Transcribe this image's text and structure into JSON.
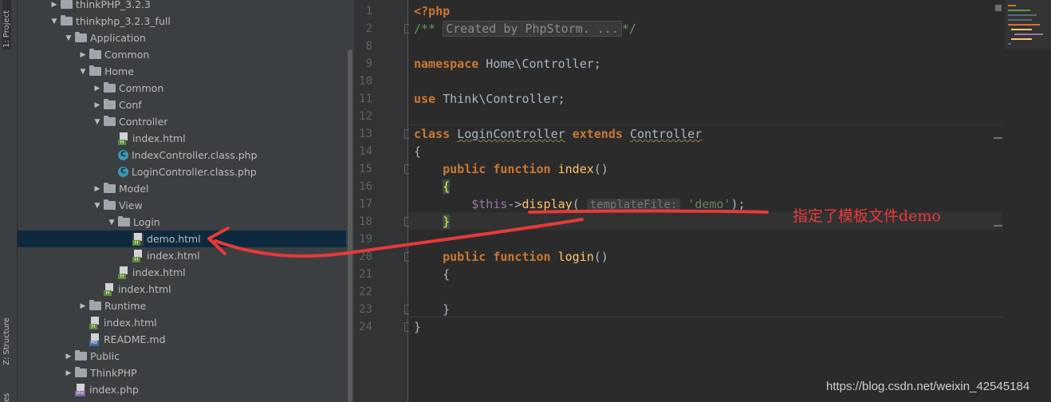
{
  "tool_strip": {
    "project_tab": "1: Project",
    "structure_tab": "Z: Structure",
    "favorites_tab": "es"
  },
  "project_tree": [
    {
      "label": "thinkPHP_3.2.3",
      "kind": "folder",
      "depth": 1,
      "expanded": false
    },
    {
      "label": "thinkphp_3.2.3_full",
      "kind": "folder",
      "depth": 1,
      "expanded": true
    },
    {
      "label": "Application",
      "kind": "folder",
      "depth": 2,
      "expanded": true
    },
    {
      "label": "Common",
      "kind": "folder",
      "depth": 3,
      "expanded": false
    },
    {
      "label": "Home",
      "kind": "folder",
      "depth": 3,
      "expanded": true
    },
    {
      "label": "Common",
      "kind": "folder",
      "depth": 4,
      "expanded": false
    },
    {
      "label": "Conf",
      "kind": "folder",
      "depth": 4,
      "expanded": false
    },
    {
      "label": "Controller",
      "kind": "folder",
      "depth": 4,
      "expanded": true
    },
    {
      "label": "index.html",
      "kind": "html",
      "depth": 5
    },
    {
      "label": "IndexController.class.php",
      "kind": "php-class",
      "depth": 5
    },
    {
      "label": "LoginController.class.php",
      "kind": "php-class",
      "depth": 5
    },
    {
      "label": "Model",
      "kind": "folder",
      "depth": 4,
      "expanded": false
    },
    {
      "label": "View",
      "kind": "folder",
      "depth": 4,
      "expanded": true
    },
    {
      "label": "Login",
      "kind": "folder",
      "depth": 5,
      "expanded": true
    },
    {
      "label": "demo.html",
      "kind": "html",
      "depth": 6,
      "selected": true
    },
    {
      "label": "index.html",
      "kind": "html",
      "depth": 6
    },
    {
      "label": "index.html",
      "kind": "html",
      "depth": 5
    },
    {
      "label": "index.html",
      "kind": "html",
      "depth": 4
    },
    {
      "label": "Runtime",
      "kind": "folder",
      "depth": 3,
      "expanded": false
    },
    {
      "label": "index.html",
      "kind": "html",
      "depth": 3
    },
    {
      "label": "README.md",
      "kind": "md",
      "depth": 3
    },
    {
      "label": "Public",
      "kind": "folder",
      "depth": 2,
      "expanded": false
    },
    {
      "label": "ThinkPHP",
      "kind": "folder",
      "depth": 2,
      "expanded": false
    },
    {
      "label": "index.php",
      "kind": "php",
      "depth": 2
    }
  ],
  "editor": {
    "line_numbers": [
      "1",
      "2",
      "8",
      "9",
      "10",
      "11",
      "12",
      "13",
      "14",
      "15",
      "16",
      "17",
      "18",
      "19",
      "20",
      "21",
      "22",
      "23",
      "24"
    ],
    "lines": {
      "l1": {
        "tag": "<?php"
      },
      "l2": {
        "open": "/**",
        "folded": "Created by PhpStorm. ...",
        "close": "*/"
      },
      "l9": {
        "kw": "namespace",
        "rest": " Home\\Controller;"
      },
      "l11": {
        "kw": "use",
        "rest": " Think\\Controller;"
      },
      "l13": {
        "kw1": "class",
        "name": "LoginController",
        "kw2": "extends",
        "parent": "Controller"
      },
      "l14": {
        "text": "{"
      },
      "l15": {
        "kw1": "public",
        "kw2": "function",
        "fn": "index",
        "rest": "()"
      },
      "l16": {
        "brace": "{"
      },
      "l17": {
        "var": "$this",
        "arrow": "->",
        "fn": "display",
        "paren": "(",
        "hint": "templateFile:",
        "str": "'demo'",
        "end": ");"
      },
      "l18": {
        "brace": "}"
      },
      "l20": {
        "kw1": "public",
        "kw2": "function",
        "fn": "login",
        "rest": "()"
      },
      "l21": {
        "text": "{"
      },
      "l23": {
        "text": "}"
      },
      "l24": {
        "text": "}"
      }
    }
  },
  "annotation": {
    "note": "指定了模板文件demo",
    "color": "#e8393a"
  },
  "watermark": "https://blog.csdn.net/weixin_42545184",
  "colors": {
    "keyword": "#cc7832",
    "function": "#ffc66d",
    "string": "#6a8759",
    "variable": "#9876aa",
    "doc_comment": "#629755",
    "selection": "#0d293e"
  }
}
